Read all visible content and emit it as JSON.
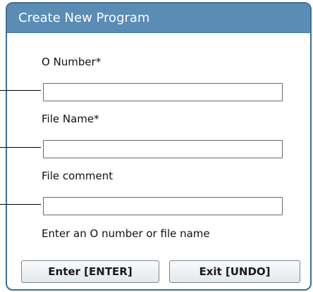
{
  "dialog": {
    "title": "Create New Program"
  },
  "fields": [
    {
      "label": "O Number*",
      "value": ""
    },
    {
      "label": "File Name*",
      "value": ""
    },
    {
      "label": "File comment",
      "value": ""
    }
  ],
  "hint": "Enter an O number or file name",
  "buttons": {
    "enter": "Enter [ENTER]",
    "exit": "Exit [UNDO]"
  },
  "colors": {
    "title_bar": "#5a8cb6",
    "border": "#3d6e96"
  }
}
